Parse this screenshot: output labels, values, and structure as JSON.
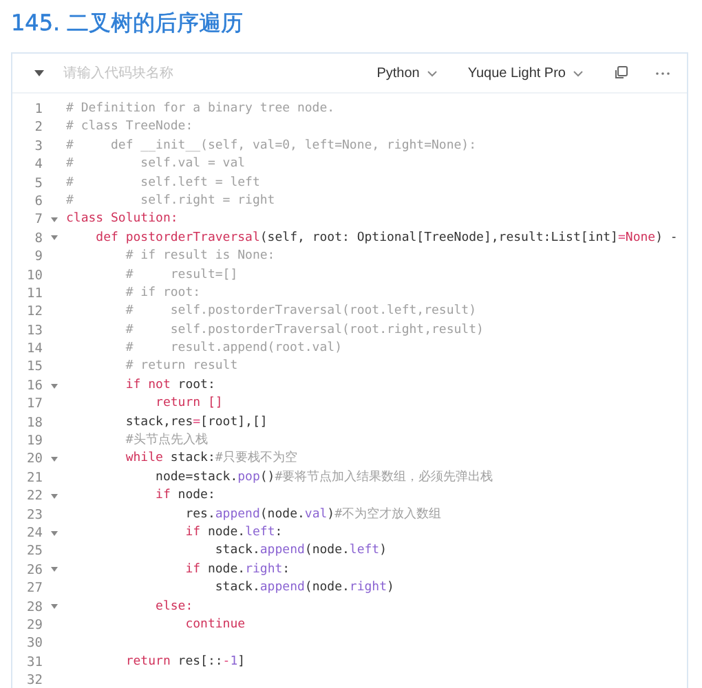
{
  "title": "145. 二叉树的后序遍历",
  "code_block": {
    "name_field": {
      "placeholder": "请输入代码块名称"
    },
    "collapsed": false,
    "language": "Python",
    "theme": "Yuque Light Pro",
    "lines": [
      {
        "number": "1",
        "foldable": false,
        "tokens": [
          {
            "kind": "comment",
            "text": "# Definition for a binary tree node."
          }
        ]
      },
      {
        "number": "2",
        "foldable": false,
        "tokens": [
          {
            "kind": "comment",
            "text": "# class TreeNode:"
          }
        ]
      },
      {
        "number": "3",
        "foldable": false,
        "tokens": [
          {
            "kind": "comment",
            "text": "#     def __init__(self, val=0, left=None, right=None):"
          }
        ]
      },
      {
        "number": "4",
        "foldable": false,
        "tokens": [
          {
            "kind": "comment",
            "text": "#         self.val = val"
          }
        ]
      },
      {
        "number": "5",
        "foldable": false,
        "tokens": [
          {
            "kind": "comment",
            "text": "#         self.left = left"
          }
        ]
      },
      {
        "number": "6",
        "foldable": false,
        "tokens": [
          {
            "kind": "comment",
            "text": "#         self.right = right"
          }
        ]
      },
      {
        "number": "7",
        "foldable": true,
        "tokens": [
          {
            "kind": "keyword",
            "text": "class Solution:"
          }
        ]
      },
      {
        "number": "8",
        "foldable": true,
        "tokens": [
          {
            "kind": "keyword",
            "text": "    def postorderTraversal"
          },
          {
            "kind": "plain",
            "text": "(self, root: Optional[TreeNode],result:List[int]"
          },
          {
            "kind": "operator",
            "text": "="
          },
          {
            "kind": "keyword",
            "text": "None"
          },
          {
            "kind": "plain",
            "text": ") -"
          }
        ]
      },
      {
        "number": "9",
        "foldable": false,
        "tokens": [
          {
            "kind": "comment",
            "text": "        # if result is None:"
          }
        ]
      },
      {
        "number": "10",
        "foldable": false,
        "tokens": [
          {
            "kind": "comment",
            "text": "        #     result=[]"
          }
        ]
      },
      {
        "number": "11",
        "foldable": false,
        "tokens": [
          {
            "kind": "comment",
            "text": "        # if root:"
          }
        ]
      },
      {
        "number": "12",
        "foldable": false,
        "tokens": [
          {
            "kind": "comment",
            "text": "        #     self.postorderTraversal(root.left,result)"
          }
        ]
      },
      {
        "number": "13",
        "foldable": false,
        "tokens": [
          {
            "kind": "comment",
            "text": "        #     self.postorderTraversal(root.right,result)"
          }
        ]
      },
      {
        "number": "14",
        "foldable": false,
        "tokens": [
          {
            "kind": "comment",
            "text": "        #     result.append(root.val)"
          }
        ]
      },
      {
        "number": "15",
        "foldable": false,
        "tokens": [
          {
            "kind": "comment",
            "text": "        # return result"
          }
        ]
      },
      {
        "number": "16",
        "foldable": true,
        "tokens": [
          {
            "kind": "keyword",
            "text": "        if not"
          },
          {
            "kind": "plain",
            "text": " root:"
          }
        ]
      },
      {
        "number": "17",
        "foldable": false,
        "tokens": [
          {
            "kind": "keyword",
            "text": "            return []"
          }
        ]
      },
      {
        "number": "18",
        "foldable": false,
        "tokens": [
          {
            "kind": "plain",
            "text": "        stack,res"
          },
          {
            "kind": "operator",
            "text": "="
          },
          {
            "kind": "plain",
            "text": "[root],[]"
          }
        ]
      },
      {
        "number": "19",
        "foldable": false,
        "tokens": [
          {
            "kind": "comment",
            "text": "        #头节点先入栈"
          }
        ]
      },
      {
        "number": "20",
        "foldable": true,
        "tokens": [
          {
            "kind": "keyword",
            "text": "        while"
          },
          {
            "kind": "plain",
            "text": " stack:"
          },
          {
            "kind": "comment",
            "text": "#只要栈不为空"
          }
        ]
      },
      {
        "number": "21",
        "foldable": false,
        "tokens": [
          {
            "kind": "plain",
            "text": "            node=stack."
          },
          {
            "kind": "method",
            "text": "pop"
          },
          {
            "kind": "plain",
            "text": "()"
          },
          {
            "kind": "comment",
            "text": "#要将节点加入结果数组，必须先弹出栈"
          }
        ]
      },
      {
        "number": "22",
        "foldable": true,
        "tokens": [
          {
            "kind": "keyword",
            "text": "            if"
          },
          {
            "kind": "plain",
            "text": " node:"
          }
        ]
      },
      {
        "number": "23",
        "foldable": false,
        "tokens": [
          {
            "kind": "plain",
            "text": "                res."
          },
          {
            "kind": "method",
            "text": "append"
          },
          {
            "kind": "plain",
            "text": "(node."
          },
          {
            "kind": "method",
            "text": "val"
          },
          {
            "kind": "plain",
            "text": ")"
          },
          {
            "kind": "comment",
            "text": "#不为空才放入数组"
          }
        ]
      },
      {
        "number": "24",
        "foldable": true,
        "tokens": [
          {
            "kind": "keyword",
            "text": "                if"
          },
          {
            "kind": "plain",
            "text": " node."
          },
          {
            "kind": "method",
            "text": "left"
          },
          {
            "kind": "plain",
            "text": ":"
          }
        ]
      },
      {
        "number": "25",
        "foldable": false,
        "tokens": [
          {
            "kind": "plain",
            "text": "                    stack."
          },
          {
            "kind": "method",
            "text": "append"
          },
          {
            "kind": "plain",
            "text": "(node."
          },
          {
            "kind": "method",
            "text": "left"
          },
          {
            "kind": "plain",
            "text": ")"
          }
        ]
      },
      {
        "number": "26",
        "foldable": true,
        "tokens": [
          {
            "kind": "keyword",
            "text": "                if"
          },
          {
            "kind": "plain",
            "text": " node."
          },
          {
            "kind": "method",
            "text": "right"
          },
          {
            "kind": "plain",
            "text": ":"
          }
        ]
      },
      {
        "number": "27",
        "foldable": false,
        "tokens": [
          {
            "kind": "plain",
            "text": "                    stack."
          },
          {
            "kind": "method",
            "text": "append"
          },
          {
            "kind": "plain",
            "text": "(node."
          },
          {
            "kind": "method",
            "text": "right"
          },
          {
            "kind": "plain",
            "text": ")"
          }
        ]
      },
      {
        "number": "28",
        "foldable": true,
        "tokens": [
          {
            "kind": "keyword",
            "text": "            else:"
          }
        ]
      },
      {
        "number": "29",
        "foldable": false,
        "tokens": [
          {
            "kind": "keyword",
            "text": "                continue"
          }
        ]
      },
      {
        "number": "30",
        "foldable": false
      },
      {
        "number": "31",
        "foldable": false,
        "tokens": [
          {
            "kind": "keyword",
            "text": "        return"
          },
          {
            "kind": "plain",
            "text": " res[::"
          },
          {
            "kind": "operator",
            "text": "-"
          },
          {
            "kind": "method",
            "text": "1"
          },
          {
            "kind": "plain",
            "text": "]"
          }
        ]
      },
      {
        "number": "32",
        "foldable": false
      }
    ]
  }
}
